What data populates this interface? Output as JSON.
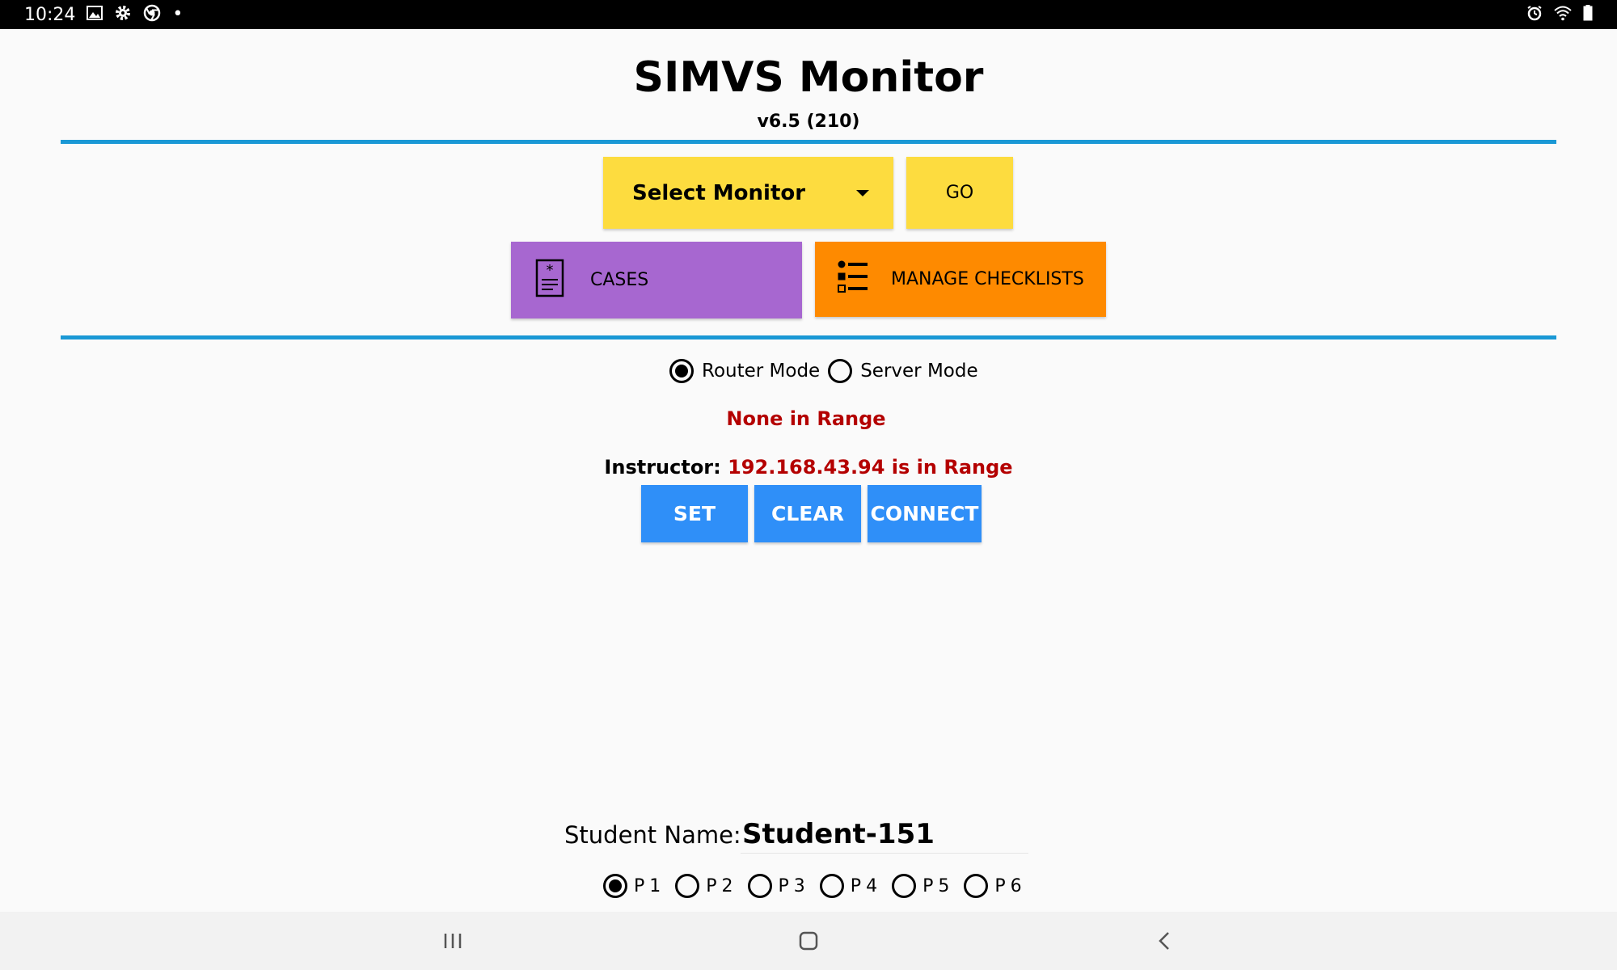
{
  "status_bar": {
    "time": "10:24",
    "left_icons": [
      "image-icon",
      "gear-icon",
      "chrome-icon",
      "dot-icon"
    ],
    "right_icons": [
      "alarm-icon",
      "wifi-icon",
      "battery-icon"
    ]
  },
  "app": {
    "title": "SIMVS Monitor",
    "version": "v6.5 (210)"
  },
  "controls": {
    "select_monitor": "Select Monitor",
    "go": "GO",
    "cases": "CASES",
    "manage_checklists": "MANAGE CHECKLISTS"
  },
  "mode": {
    "options": [
      "Router Mode",
      "Server Mode"
    ],
    "selected": "Router Mode"
  },
  "range_status": "None in Range",
  "instructor": {
    "label": "Instructor:",
    "value": "192.168.43.94 is in Range"
  },
  "actions": {
    "set": "SET",
    "clear": "CLEAR",
    "connect": "CONNECT"
  },
  "student": {
    "label": "Student Name:",
    "value": "Student-151"
  },
  "patients": {
    "options": [
      "P1",
      "P2",
      "P3",
      "P4",
      "P5",
      "P6"
    ],
    "selected": "P1"
  },
  "colors": {
    "accent_rule": "#1a98d5",
    "yellow": "#fddc3f",
    "purple": "#a767d0",
    "orange": "#fe8a00",
    "blue": "#2f8ff8",
    "alert_red": "#b40000"
  }
}
